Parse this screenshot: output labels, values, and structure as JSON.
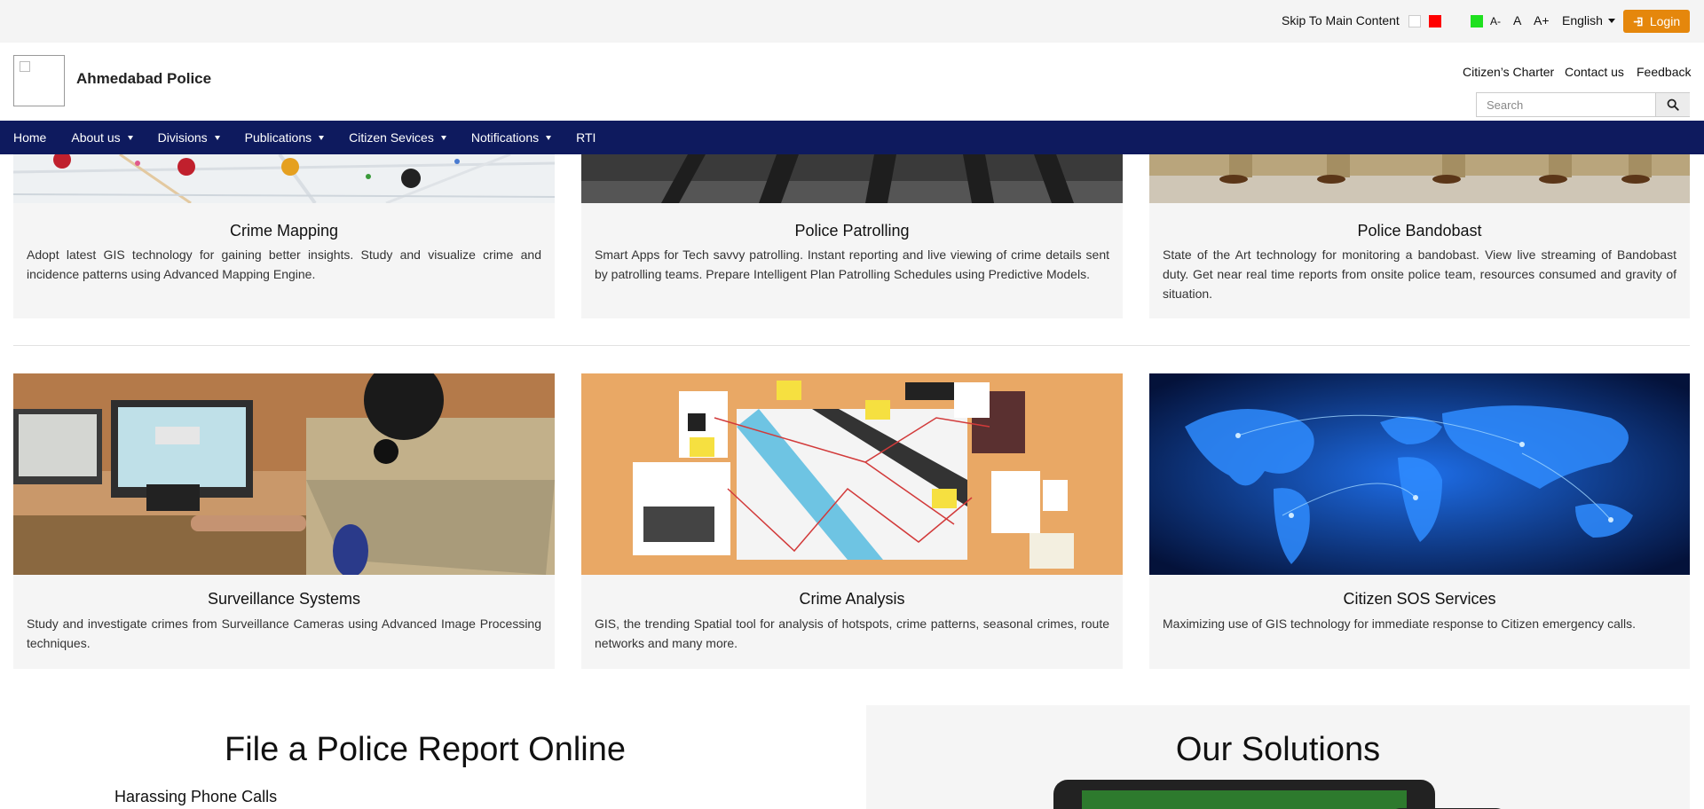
{
  "topbar": {
    "skip_link": "Skip To Main Content",
    "font_small": "A-",
    "font_normal": "A",
    "font_large": "A+",
    "language": "English",
    "login_label": "Login",
    "theme_colors": [
      "#ffffff",
      "#ff0000",
      "#1ee01e"
    ]
  },
  "header": {
    "site_name": "Ahmedabad Police",
    "links": {
      "charter": "Citizen’s Charter",
      "contact": "Contact us",
      "feedback": "Feedback"
    },
    "search_placeholder": "Search"
  },
  "nav": {
    "home": "Home",
    "about": "About us",
    "divisions": "Divisions",
    "publications": "Publications",
    "citizen_services": "Citizen Sevices",
    "notifications": "Notifications",
    "rti": "RTI",
    "bg_color": "#0e1a5e"
  },
  "cards_row1": [
    {
      "title": "Crime Mapping",
      "description": "Adopt latest GIS technology for gaining better insights. Study and visualize crime and incidence patterns using Advanced Mapping Engine."
    },
    {
      "title": "Police Patrolling",
      "description": "Smart Apps for Tech savvy patrolling. Instant reporting and live viewing of crime details sent by patrolling teams. Prepare Intelligent Plan Patrolling Schedules using Predictive Models."
    },
    {
      "title": "Police Bandobast",
      "description": "State of the Art technology for monitoring a bandobast. View live streaming of Bandobast duty. Get near real time reports from onsite police team, resources consumed and gravity of situation."
    }
  ],
  "cards_row2": [
    {
      "title": "Surveillance Systems",
      "description": "Study and investigate crimes from Surveillance Cameras using Advanced Image Processing techniques."
    },
    {
      "title": "Crime Analysis",
      "description": "GIS, the trending Spatial tool for analysis of hotspots, crime patterns, seasonal crimes, route networks and many more."
    },
    {
      "title": "Citizen SOS Services",
      "description": "Maximizing use of GIS technology for immediate response to Citizen emergency calls."
    }
  ],
  "report": {
    "title": "File a Police Report Online",
    "first_item": "Harassing Phone Calls"
  },
  "solutions": {
    "title": "Our Solutions"
  },
  "accent_color": "#e5870c"
}
